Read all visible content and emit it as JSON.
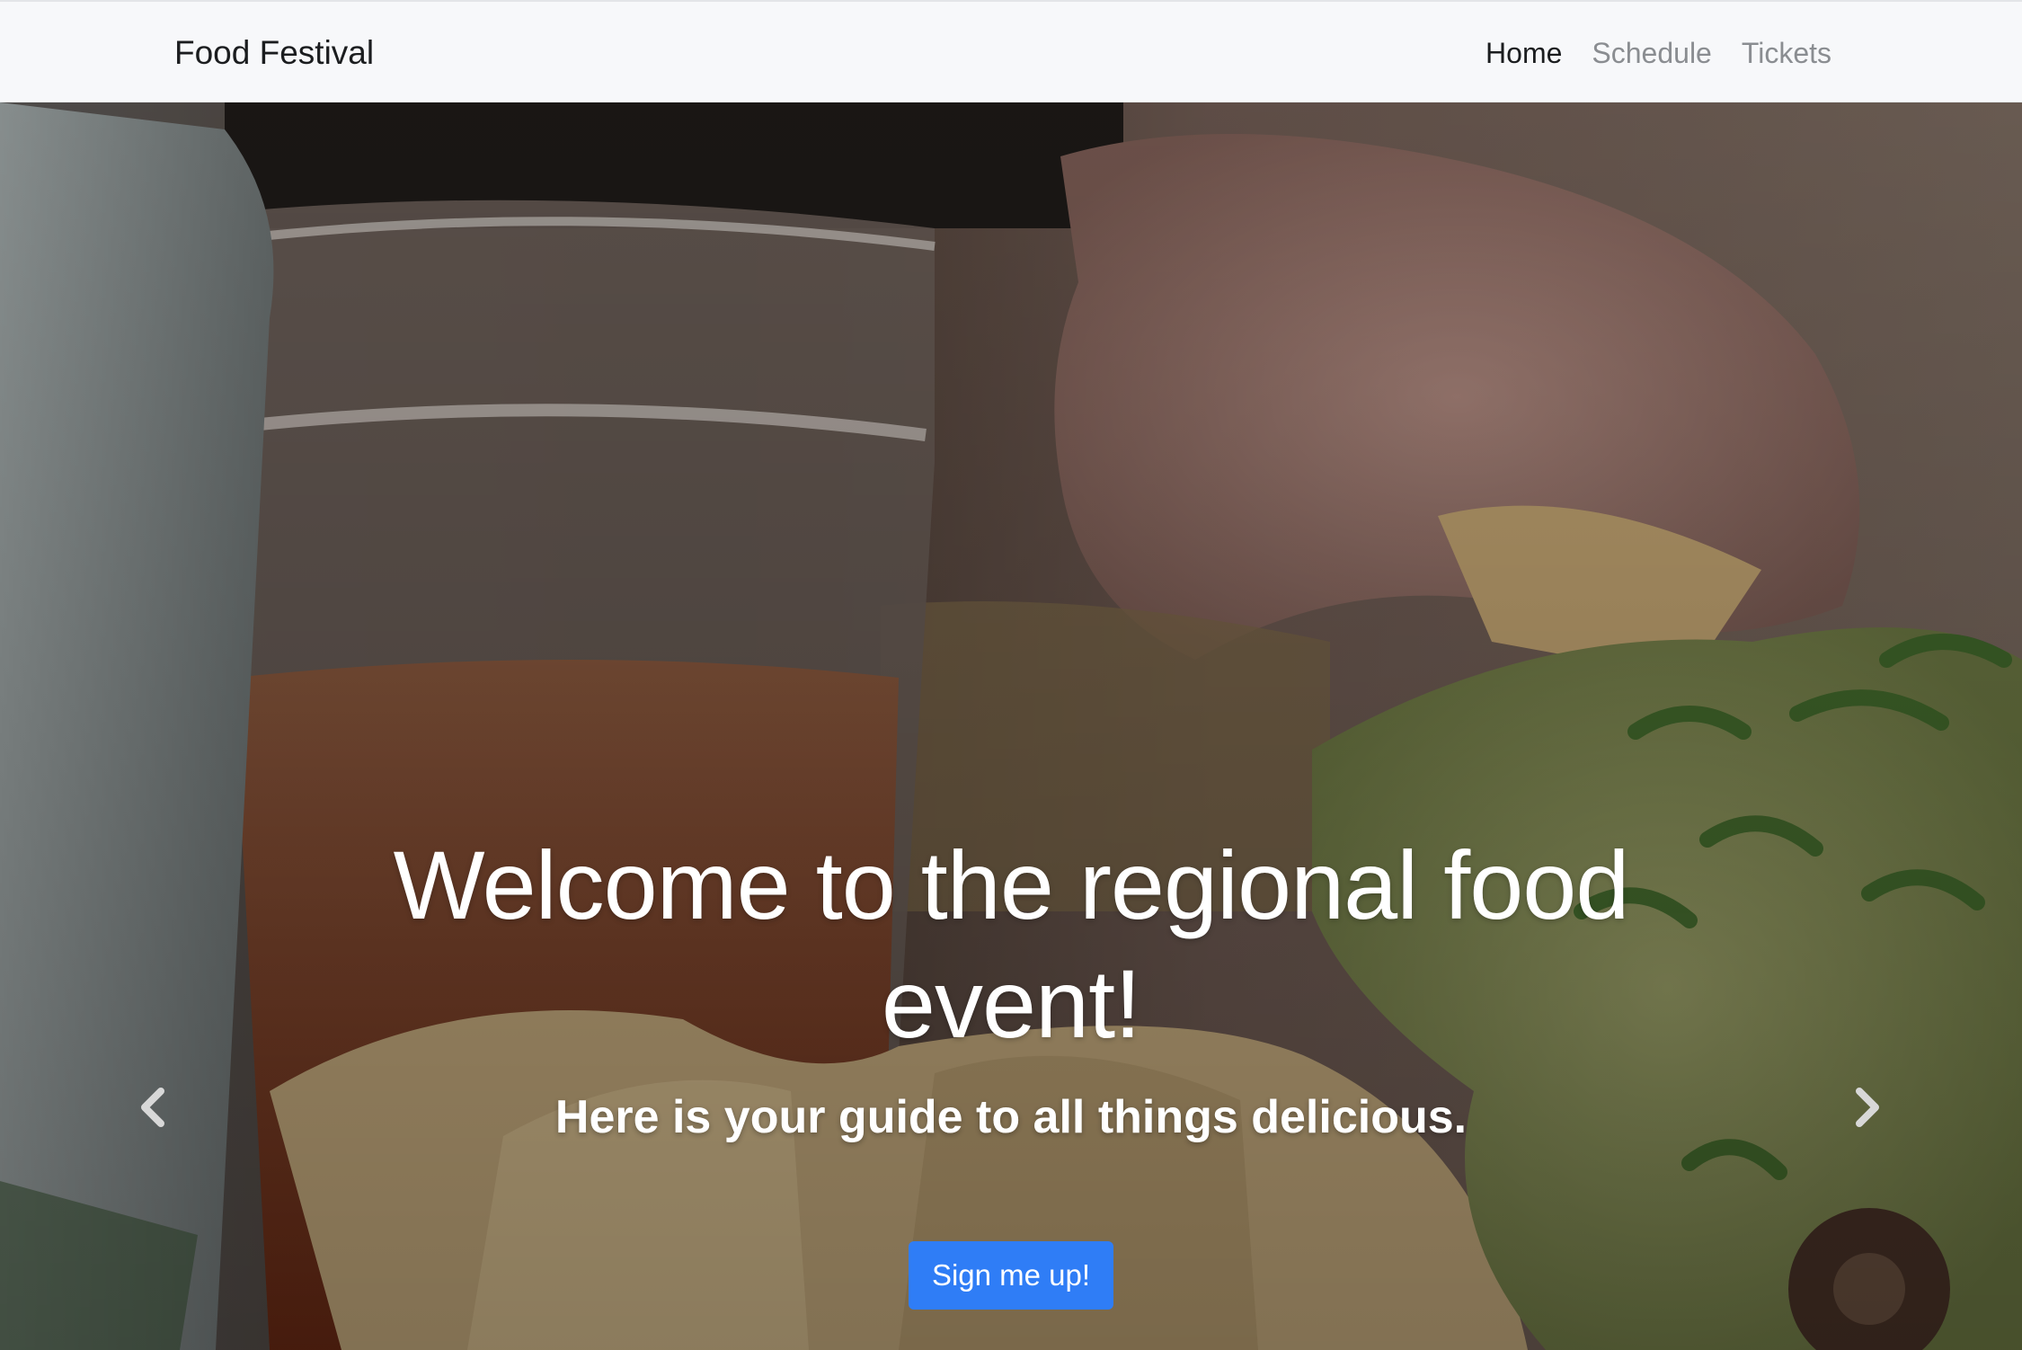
{
  "navbar": {
    "brand": "Food Festival",
    "links": [
      {
        "label": "Home",
        "active": true
      },
      {
        "label": "Schedule",
        "active": false
      },
      {
        "label": "Tickets",
        "active": false
      }
    ]
  },
  "hero": {
    "headline": "Welcome to the regional food event!",
    "subheadline": "Here is your guide to all things delicious.",
    "cta_label": "Sign me up!",
    "prev_icon": "chevron-left-icon",
    "next_icon": "chevron-right-icon"
  },
  "colors": {
    "navbar_bg": "#f7f8fa",
    "active_link": "#1b1d1f",
    "inactive_link": "#8a8d91",
    "cta_bg": "#2f7df6"
  }
}
